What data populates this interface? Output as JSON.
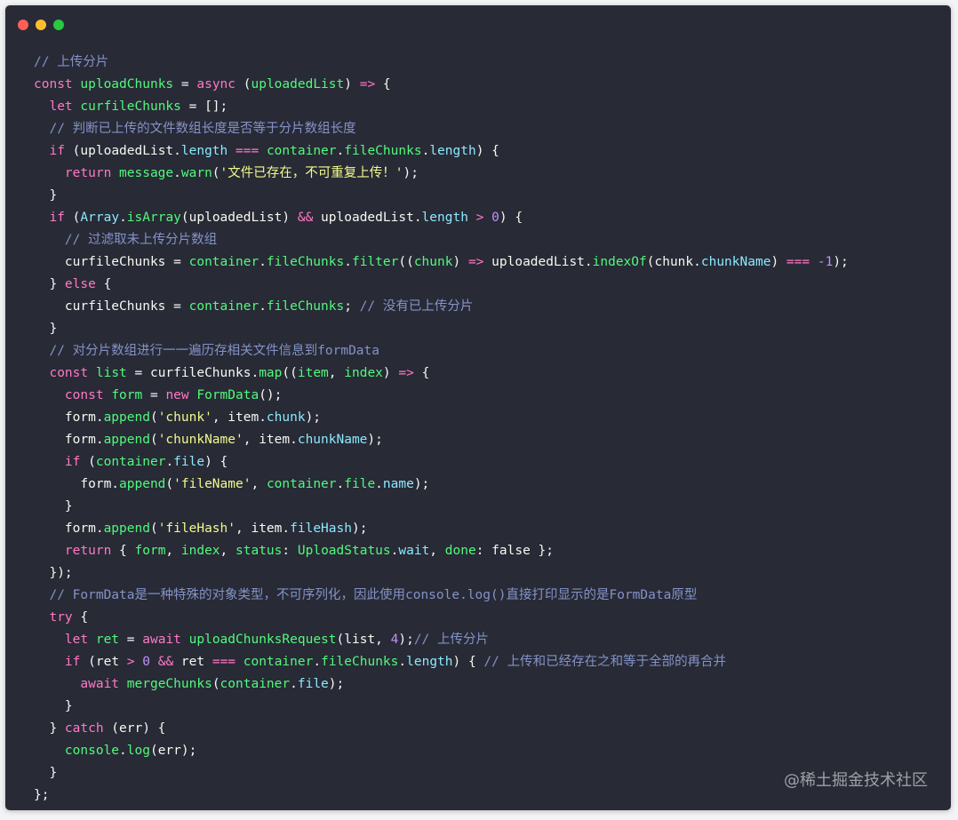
{
  "colors": {
    "background": "#282a36",
    "comment": "#8493c7",
    "keyword": "#ff79c6",
    "function": "#50fa7b",
    "property": "#8be9fd",
    "string": "#f1fa8c",
    "number": "#bd93f9",
    "text": "#f8f8f2"
  },
  "window_controls": [
    "close-dot",
    "minimize-dot",
    "maximize-dot"
  ],
  "watermark": "@稀土掘金技术社区",
  "code_lines": [
    [
      [
        "comment",
        "// 上传分片"
      ]
    ],
    [
      [
        "keyword",
        "const "
      ],
      [
        "func",
        "uploadChunks"
      ],
      [
        "punct",
        " = "
      ],
      [
        "keyword",
        "async "
      ],
      [
        "punct",
        "("
      ],
      [
        "func",
        "uploadedList"
      ],
      [
        "punct",
        ") "
      ],
      [
        "op",
        "=>"
      ],
      [
        "punct",
        " {"
      ]
    ],
    [
      [
        "punct",
        "  "
      ],
      [
        "keyword",
        "let "
      ],
      [
        "func",
        "curfileChunks"
      ],
      [
        "punct",
        " = [];"
      ]
    ],
    [
      [
        "punct",
        "  "
      ],
      [
        "comment",
        "// 判断已上传的文件数组长度是否等于分片数组长度"
      ]
    ],
    [
      [
        "punct",
        "  "
      ],
      [
        "keyword",
        "if "
      ],
      [
        "punct",
        "(uploadedList."
      ],
      [
        "prop",
        "length"
      ],
      [
        "punct",
        " "
      ],
      [
        "op",
        "==="
      ],
      [
        "punct",
        " "
      ],
      [
        "func",
        "container"
      ],
      [
        "punct",
        "."
      ],
      [
        "func",
        "fileChunks"
      ],
      [
        "punct",
        "."
      ],
      [
        "prop",
        "length"
      ],
      [
        "punct",
        ") {"
      ]
    ],
    [
      [
        "punct",
        "    "
      ],
      [
        "keyword",
        "return "
      ],
      [
        "func",
        "message"
      ],
      [
        "punct",
        "."
      ],
      [
        "func",
        "warn"
      ],
      [
        "punct",
        "("
      ],
      [
        "string",
        "'文件已存在，不可重复上传！'"
      ],
      [
        "punct",
        ");"
      ]
    ],
    [
      [
        "punct",
        "  }"
      ]
    ],
    [
      [
        "punct",
        "  "
      ],
      [
        "keyword",
        "if "
      ],
      [
        "punct",
        "("
      ],
      [
        "class",
        "Array"
      ],
      [
        "punct",
        "."
      ],
      [
        "func",
        "isArray"
      ],
      [
        "punct",
        "(uploadedList) "
      ],
      [
        "op",
        "&&"
      ],
      [
        "punct",
        " uploadedList."
      ],
      [
        "prop",
        "length"
      ],
      [
        "punct",
        " "
      ],
      [
        "op",
        ">"
      ],
      [
        "punct",
        " "
      ],
      [
        "number",
        "0"
      ],
      [
        "punct",
        ") {"
      ]
    ],
    [
      [
        "punct",
        "    "
      ],
      [
        "comment",
        "// 过滤取未上传分片数组"
      ]
    ],
    [
      [
        "punct",
        "    curfileChunks = "
      ],
      [
        "func",
        "container"
      ],
      [
        "punct",
        "."
      ],
      [
        "func",
        "fileChunks"
      ],
      [
        "punct",
        "."
      ],
      [
        "func",
        "filter"
      ],
      [
        "punct",
        "(("
      ],
      [
        "func",
        "chunk"
      ],
      [
        "punct",
        ") "
      ],
      [
        "op",
        "=>"
      ],
      [
        "punct",
        " uploadedList."
      ],
      [
        "func",
        "indexOf"
      ],
      [
        "punct",
        "(chunk."
      ],
      [
        "prop",
        "chunkName"
      ],
      [
        "punct",
        ") "
      ],
      [
        "op",
        "==="
      ],
      [
        "punct",
        " "
      ],
      [
        "number",
        "-1"
      ],
      [
        "punct",
        ");"
      ]
    ],
    [
      [
        "punct",
        "  } "
      ],
      [
        "keyword",
        "else"
      ],
      [
        "punct",
        " {"
      ]
    ],
    [
      [
        "punct",
        "    curfileChunks = "
      ],
      [
        "func",
        "container"
      ],
      [
        "punct",
        "."
      ],
      [
        "func",
        "fileChunks"
      ],
      [
        "punct",
        "; "
      ],
      [
        "comment",
        "// 没有已上传分片"
      ]
    ],
    [
      [
        "punct",
        "  }"
      ]
    ],
    [
      [
        "punct",
        "  "
      ],
      [
        "comment",
        "// 对分片数组进行一一遍历存相关文件信息到formData"
      ]
    ],
    [
      [
        "punct",
        "  "
      ],
      [
        "keyword",
        "const "
      ],
      [
        "func",
        "list"
      ],
      [
        "punct",
        " = curfileChunks."
      ],
      [
        "func",
        "map"
      ],
      [
        "punct",
        "(("
      ],
      [
        "func",
        "item"
      ],
      [
        "punct",
        ", "
      ],
      [
        "func",
        "index"
      ],
      [
        "punct",
        ") "
      ],
      [
        "op",
        "=>"
      ],
      [
        "punct",
        " {"
      ]
    ],
    [
      [
        "punct",
        "    "
      ],
      [
        "keyword",
        "const "
      ],
      [
        "func",
        "form"
      ],
      [
        "punct",
        " = "
      ],
      [
        "keyword",
        "new "
      ],
      [
        "func",
        "FormData"
      ],
      [
        "punct",
        "();"
      ]
    ],
    [
      [
        "punct",
        "    form."
      ],
      [
        "func",
        "append"
      ],
      [
        "punct",
        "("
      ],
      [
        "string",
        "'chunk'"
      ],
      [
        "punct",
        ", item."
      ],
      [
        "prop",
        "chunk"
      ],
      [
        "punct",
        ");"
      ]
    ],
    [
      [
        "punct",
        "    form."
      ],
      [
        "func",
        "append"
      ],
      [
        "punct",
        "("
      ],
      [
        "string",
        "'chunkName'"
      ],
      [
        "punct",
        ", item."
      ],
      [
        "prop",
        "chunkName"
      ],
      [
        "punct",
        ");"
      ]
    ],
    [
      [
        "punct",
        "    "
      ],
      [
        "keyword",
        "if "
      ],
      [
        "punct",
        "("
      ],
      [
        "func",
        "container"
      ],
      [
        "punct",
        "."
      ],
      [
        "prop",
        "file"
      ],
      [
        "punct",
        ") {"
      ]
    ],
    [
      [
        "punct",
        "      form."
      ],
      [
        "func",
        "append"
      ],
      [
        "punct",
        "("
      ],
      [
        "string",
        "'fileName'"
      ],
      [
        "punct",
        ", "
      ],
      [
        "func",
        "container"
      ],
      [
        "punct",
        "."
      ],
      [
        "func",
        "file"
      ],
      [
        "punct",
        "."
      ],
      [
        "prop",
        "name"
      ],
      [
        "punct",
        ");"
      ]
    ],
    [
      [
        "punct",
        "    }"
      ]
    ],
    [
      [
        "punct",
        "    form."
      ],
      [
        "func",
        "append"
      ],
      [
        "punct",
        "("
      ],
      [
        "string",
        "'fileHash'"
      ],
      [
        "punct",
        ", item."
      ],
      [
        "prop",
        "fileHash"
      ],
      [
        "punct",
        ");"
      ]
    ],
    [
      [
        "punct",
        "    "
      ],
      [
        "keyword",
        "return "
      ],
      [
        "punct",
        "{ "
      ],
      [
        "func",
        "form"
      ],
      [
        "punct",
        ", "
      ],
      [
        "func",
        "index"
      ],
      [
        "punct",
        ", "
      ],
      [
        "func",
        "status"
      ],
      [
        "punct",
        ": "
      ],
      [
        "func",
        "UploadStatus"
      ],
      [
        "punct",
        "."
      ],
      [
        "prop",
        "wait"
      ],
      [
        "punct",
        ", "
      ],
      [
        "func",
        "done"
      ],
      [
        "punct",
        ": false };"
      ]
    ],
    [
      [
        "punct",
        "  });"
      ]
    ],
    [
      [
        "punct",
        "  "
      ],
      [
        "comment",
        "// FormData是一种特殊的对象类型，不可序列化，因此使用console.log()直接打印显示的是FormData原型"
      ]
    ],
    [
      [
        "punct",
        "  "
      ],
      [
        "keyword",
        "try"
      ],
      [
        "punct",
        " {"
      ]
    ],
    [
      [
        "punct",
        "    "
      ],
      [
        "keyword",
        "let "
      ],
      [
        "func",
        "ret"
      ],
      [
        "punct",
        " = "
      ],
      [
        "keyword",
        "await "
      ],
      [
        "func",
        "uploadChunksRequest"
      ],
      [
        "punct",
        "(list, "
      ],
      [
        "number",
        "4"
      ],
      [
        "punct",
        ");"
      ],
      [
        "comment",
        "// 上传分片"
      ]
    ],
    [
      [
        "punct",
        "    "
      ],
      [
        "keyword",
        "if "
      ],
      [
        "punct",
        "(ret "
      ],
      [
        "op",
        ">"
      ],
      [
        "punct",
        " "
      ],
      [
        "number",
        "0"
      ],
      [
        "punct",
        " "
      ],
      [
        "op",
        "&&"
      ],
      [
        "punct",
        " ret "
      ],
      [
        "op",
        "==="
      ],
      [
        "punct",
        " "
      ],
      [
        "func",
        "container"
      ],
      [
        "punct",
        "."
      ],
      [
        "func",
        "fileChunks"
      ],
      [
        "punct",
        "."
      ],
      [
        "prop",
        "length"
      ],
      [
        "punct",
        ") { "
      ],
      [
        "comment",
        "// 上传和已经存在之和等于全部的再合并"
      ]
    ],
    [
      [
        "punct",
        "      "
      ],
      [
        "keyword",
        "await "
      ],
      [
        "func",
        "mergeChunks"
      ],
      [
        "punct",
        "("
      ],
      [
        "func",
        "container"
      ],
      [
        "punct",
        "."
      ],
      [
        "prop",
        "file"
      ],
      [
        "punct",
        ");"
      ]
    ],
    [
      [
        "punct",
        "    }"
      ]
    ],
    [
      [
        "punct",
        "  } "
      ],
      [
        "keyword",
        "catch"
      ],
      [
        "punct",
        " (err) {"
      ]
    ],
    [
      [
        "punct",
        "    "
      ],
      [
        "func",
        "console"
      ],
      [
        "punct",
        "."
      ],
      [
        "func",
        "log"
      ],
      [
        "punct",
        "(err);"
      ]
    ],
    [
      [
        "punct",
        "  }"
      ]
    ],
    [
      [
        "punct",
        "};"
      ]
    ]
  ]
}
